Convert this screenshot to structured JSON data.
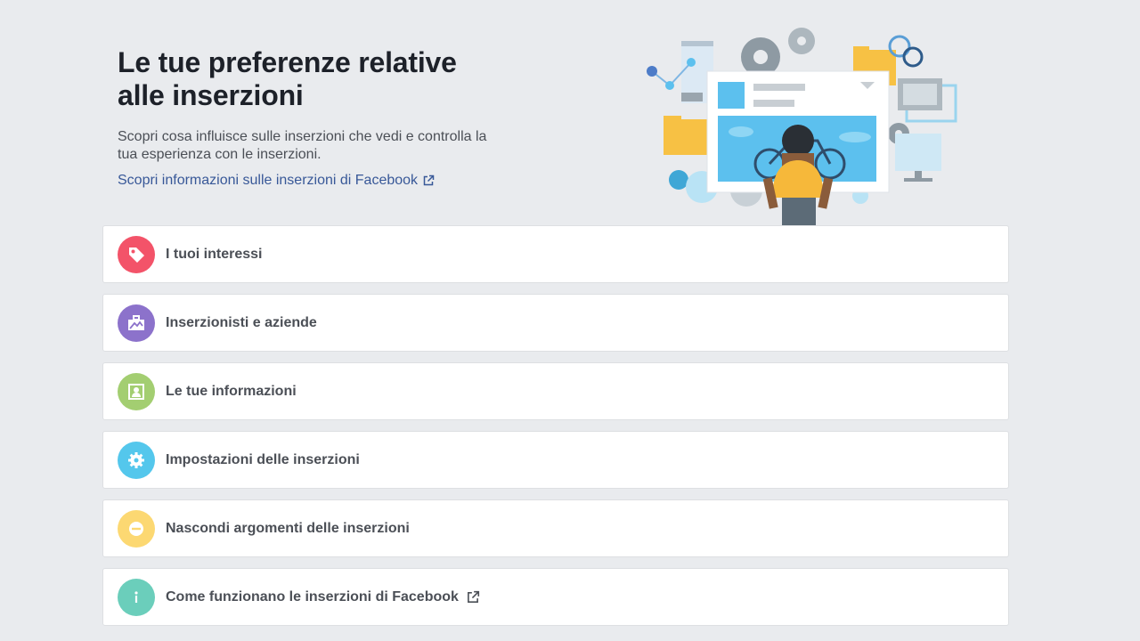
{
  "header": {
    "title_line1": "Le tue preferenze relative",
    "title_line2": "alle inserzioni",
    "subtitle": "Scopri cosa influisce sulle inserzioni che vedi e controlla la tua esperienza con le inserzioni.",
    "learn_link": "Scopri informazioni sulle inserzioni di Facebook"
  },
  "sections": [
    {
      "label": "I tuoi interessi",
      "icon": "tag-icon",
      "color": "#f35369"
    },
    {
      "label": "Inserzionisti e aziende",
      "icon": "briefcase-icon",
      "color": "#8c72cb"
    },
    {
      "label": "Le tue informazioni",
      "icon": "profile-card-icon",
      "color": "#a3ce71"
    },
    {
      "label": "Impostazioni delle inserzioni",
      "icon": "gear-icon",
      "color": "#54c7ec"
    },
    {
      "label": "Nascondi argomenti delle inserzioni",
      "icon": "hide-minus-icon",
      "color": "#fcd872"
    },
    {
      "label": "Come funzionano le inserzioni di Facebook",
      "icon": "info-icon",
      "color": "#6bcebb"
    }
  ],
  "colors": {
    "background": "#e9ebee",
    "link": "#385898",
    "card_border": "#dddfe2",
    "label_text": "#4b4f56"
  }
}
